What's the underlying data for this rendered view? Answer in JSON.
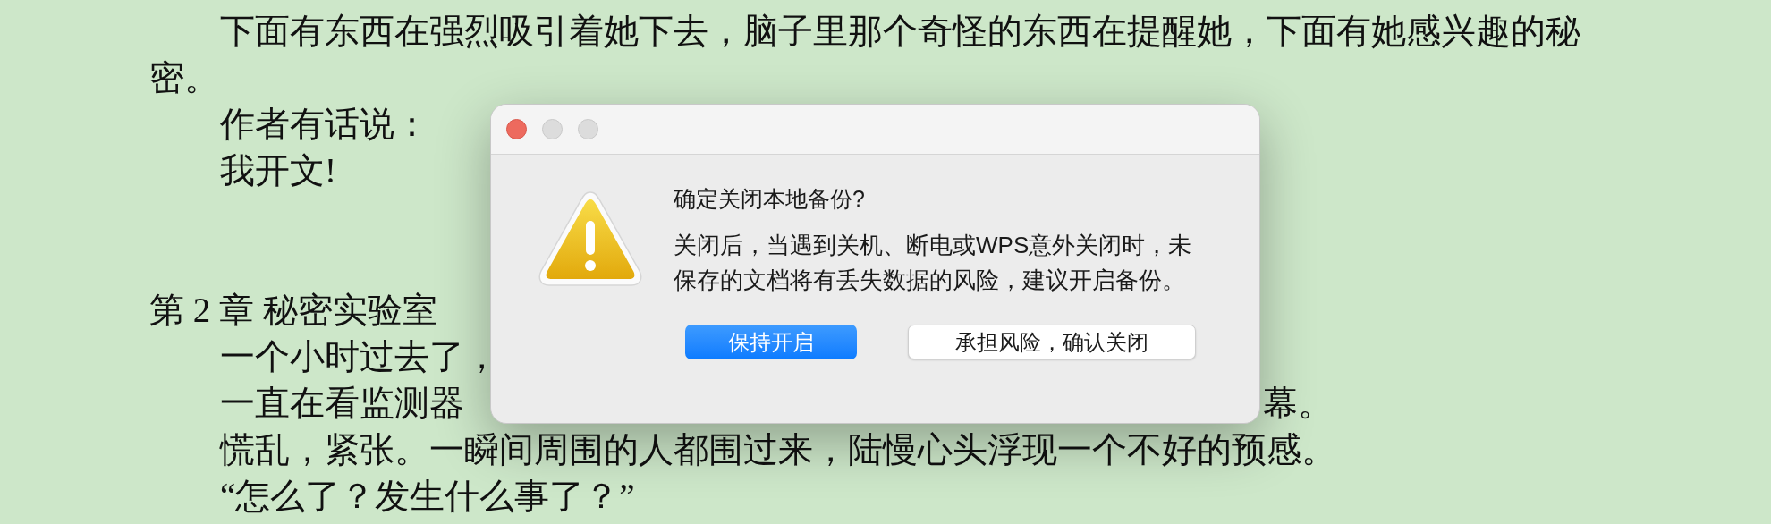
{
  "document": {
    "lines": [
      {
        "kind": "paragraph",
        "indent": true,
        "text": "下面有东西在强烈吸引着她下去，脑子里那个奇怪的东西在提醒她，下面有她感兴趣的秘密。"
      },
      {
        "kind": "paragraph",
        "indent": true,
        "text": "作者有话说："
      },
      {
        "kind": "paragraph",
        "indent": true,
        "text": "我开文!"
      },
      {
        "kind": "blank"
      },
      {
        "kind": "blank"
      },
      {
        "kind": "paragraph",
        "indent": false,
        "text": "第 2 章  秘密实验室"
      },
      {
        "kind": "paragraph",
        "indent": true,
        "text": "一个小时过去了，"
      },
      {
        "kind": "split",
        "indent": true,
        "parts": [
          "一直在看监测器",
          "幕。"
        ]
      },
      {
        "kind": "paragraph",
        "indent": true,
        "text": "慌乱，紧张。一瞬间周围的人都围过来，陆慢心头浮现一个不好的预感。"
      },
      {
        "kind": "paragraph",
        "indent": true,
        "text": "“怎么了？发生什么事了？”"
      }
    ]
  },
  "dialog": {
    "title": "确定关闭本地备份?",
    "message": "关闭后，当遇到关机、断电或WPS意外关闭时，未保存的文档将有丢失数据的风险，建议开启备份。",
    "buttons": [
      {
        "label": "保持开启",
        "default": true
      },
      {
        "label": "承担风险，确认关闭",
        "default": false
      }
    ]
  }
}
